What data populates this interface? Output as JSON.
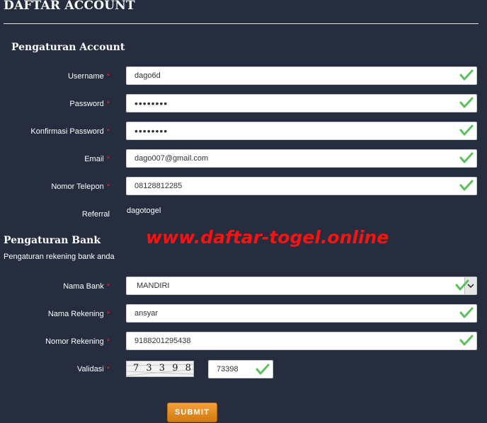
{
  "page": {
    "title": "DAFTAR ACCOUNT"
  },
  "account_section": {
    "title": "Pengaturan Account",
    "fields": [
      {
        "label": "Username",
        "required": "*",
        "value": "dago6d"
      },
      {
        "label": "Password",
        "required": "*",
        "value": "••••••••"
      },
      {
        "label": "Konfirmasi Password",
        "required": "*",
        "value": "••••••••"
      },
      {
        "label": "Email",
        "required": "*",
        "value": "dago007@gmail.com"
      },
      {
        "label": "Nomor Telepon",
        "required": "*",
        "value": "08128812285"
      }
    ],
    "referral": {
      "label": "Referral",
      "value": "dagotogel"
    }
  },
  "bank_section": {
    "title": "Pengaturan Bank",
    "subtitle": "Pengaturan rekening bank anda",
    "bank_name": {
      "label": "Nama Bank",
      "required": "*",
      "value": "MANDIRI"
    },
    "account_name": {
      "label": "Nama Rekening",
      "required": "*",
      "value": "ansyar"
    },
    "account_number": {
      "label": "Nomor Rekening",
      "required": "*",
      "value": "9188201295438"
    },
    "validation": {
      "label": "Validasi",
      "required": "*",
      "captcha_text": "7 3 3 9 8",
      "value": "73398"
    }
  },
  "watermark": "www.daftar-togel.online",
  "submit_label": "SUBMIT",
  "colors": {
    "background": "#252d3e",
    "required": "#e0252c",
    "check": "#5cc15c",
    "watermark": "#ff1010",
    "button": "#e08c20"
  },
  "icons": {
    "valid": "check-icon",
    "dropdown": "chevron-down-icon"
  }
}
